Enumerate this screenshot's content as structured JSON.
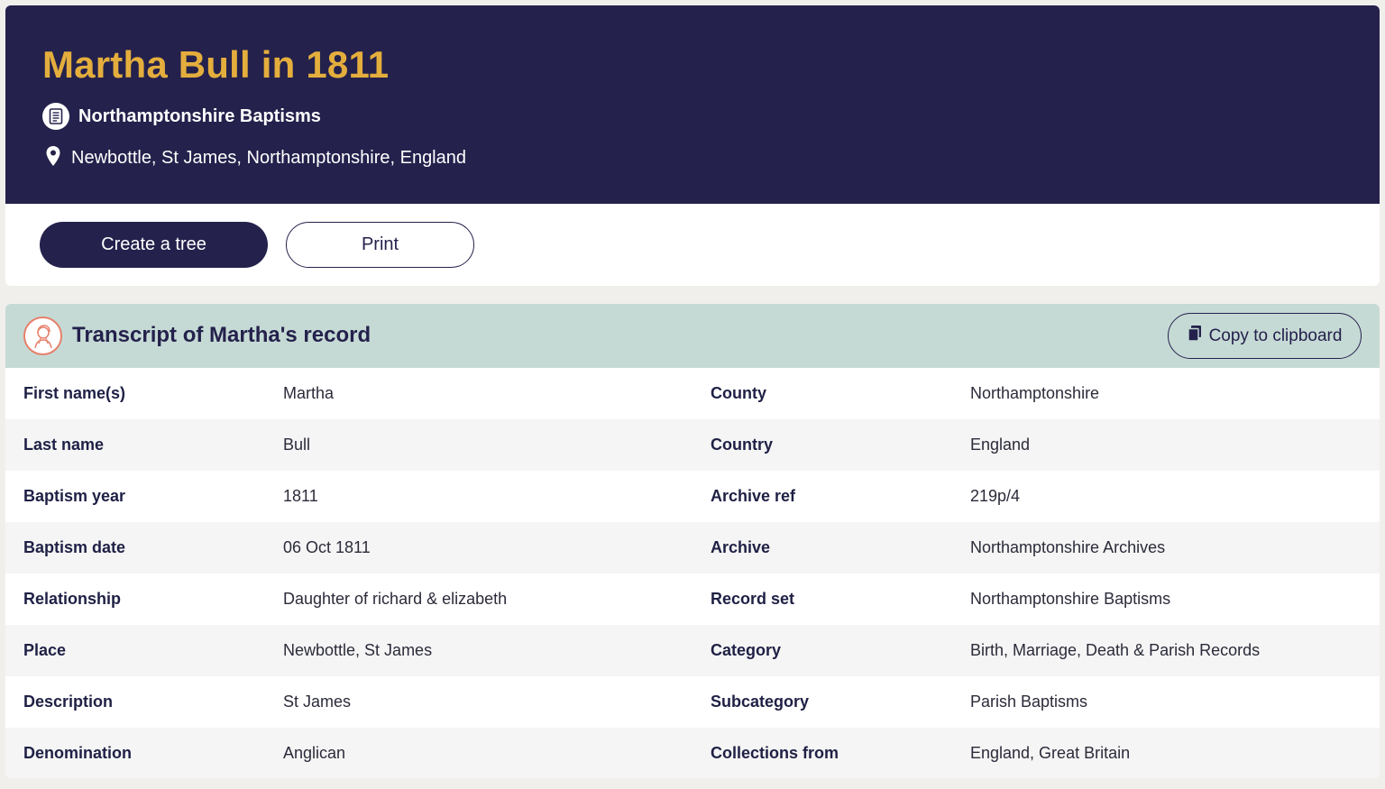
{
  "header": {
    "title": "Martha Bull in 1811",
    "collection": "Northamptonshire Baptisms",
    "collection_icon": "document-icon",
    "place": "Newbottle, St James, Northamptonshire, England",
    "place_icon": "map-pin-icon",
    "background_color": "#24214c",
    "title_color": "#e4ae3d"
  },
  "actions": {
    "create_tree_label": "Create a tree",
    "print_label": "Print"
  },
  "transcript": {
    "title": "Transcript of Martha's record",
    "copy_label": "Copy to clipboard",
    "header_color": "#c6dad5",
    "rows": [
      {
        "label1": "First name(s)",
        "value1": "Martha",
        "label2": "County",
        "value2": "Northamptonshire"
      },
      {
        "label1": "Last name",
        "value1": "Bull",
        "label2": "Country",
        "value2": "England"
      },
      {
        "label1": "Baptism year",
        "value1": "1811",
        "label2": "Archive ref",
        "value2": "219p/4"
      },
      {
        "label1": "Baptism date",
        "value1": "06 Oct 1811",
        "label2": "Archive",
        "value2": "Northamptonshire Archives"
      },
      {
        "label1": "Relationship",
        "value1": "Daughter of richard & elizabeth",
        "label2": "Record set",
        "value2": "Northamptonshire Baptisms"
      },
      {
        "label1": "Place",
        "value1": "Newbottle, St James",
        "label2": "Category",
        "value2": "Birth, Marriage, Death & Parish Records"
      },
      {
        "label1": "Description",
        "value1": "St James",
        "label2": "Subcategory",
        "value2": "Parish Baptisms"
      },
      {
        "label1": "Denomination",
        "value1": "Anglican",
        "label2": "Collections from",
        "value2": "England, Great Britain"
      }
    ]
  }
}
